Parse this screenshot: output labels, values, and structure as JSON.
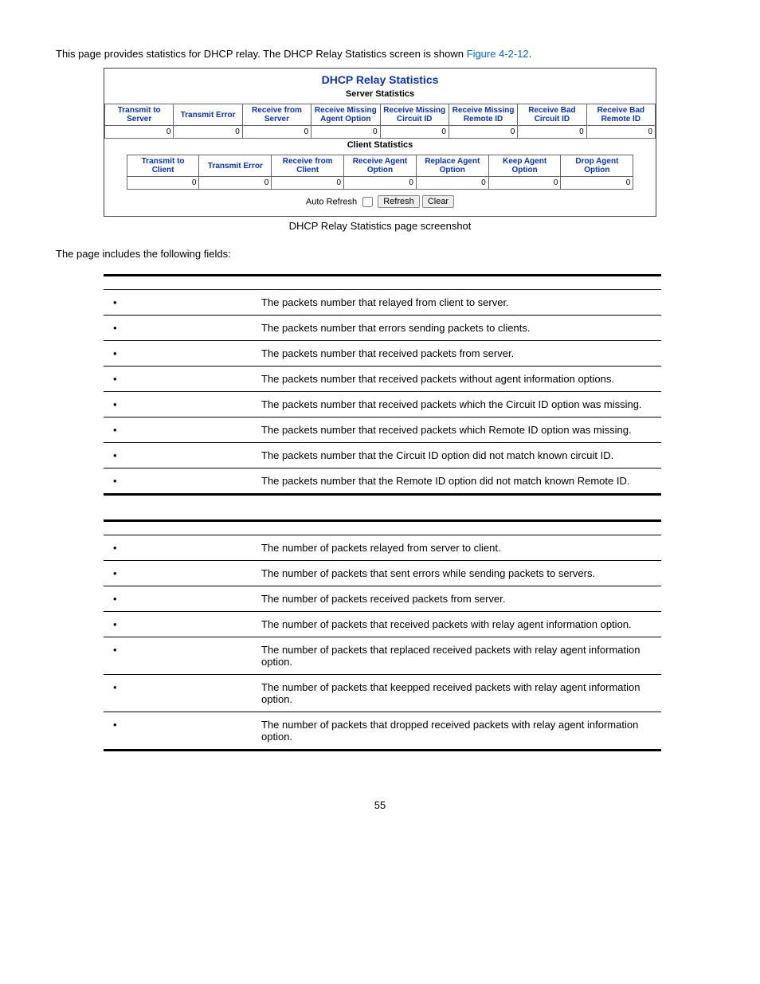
{
  "intro": {
    "text_before": "This page provides statistics for DHCP relay. The DHCP Relay Statistics screen is shown ",
    "link": "Figure 4-2-12",
    "text_after": "."
  },
  "screenshot": {
    "title": "DHCP Relay Statistics",
    "server_subtitle": "Server Statistics",
    "server_headers": [
      "Transmit to Server",
      "Transmit Error",
      "Receive from Server",
      "Receive Missing Agent Option",
      "Receive Missing Circuit ID",
      "Receive Missing Remote ID",
      "Receive Bad Circuit ID",
      "Receive Bad Remote ID"
    ],
    "server_values": [
      "0",
      "0",
      "0",
      "0",
      "0",
      "0",
      "0",
      "0"
    ],
    "client_subtitle": "Client Statistics",
    "client_headers": [
      "Transmit to Client",
      "Transmit Error",
      "Receive from Client",
      "Receive Agent Option",
      "Replace Agent Option",
      "Keep Agent Option",
      "Drop Agent Option"
    ],
    "client_values": [
      "0",
      "0",
      "0",
      "0",
      "0",
      "0",
      "0"
    ],
    "auto_refresh_label": "Auto Refresh",
    "refresh_btn": "Refresh",
    "clear_btn": "Clear"
  },
  "caption": "DHCP Relay Statistics page screenshot",
  "fields_intro": "The page includes the following fields:",
  "server_fields": [
    {
      "desc": "The packets number that relayed from client to server."
    },
    {
      "desc": "The packets number that errors sending packets to clients."
    },
    {
      "desc": "The packets number that received packets from server."
    },
    {
      "desc": "The packets number that received packets without agent information options."
    },
    {
      "desc": "The packets number that received packets which the Circuit ID option was missing."
    },
    {
      "desc": "The packets number that received packets which Remote ID option was missing."
    },
    {
      "desc": "The packets number that the Circuit ID option did not match known circuit ID."
    },
    {
      "desc": "The packets number that the Remote ID option did not match known Remote ID."
    }
  ],
  "client_fields": [
    {
      "desc": "The number of packets relayed from server to client."
    },
    {
      "desc": "The number of packets that sent errors while sending packets to servers."
    },
    {
      "desc": "The number of packets received packets from server."
    },
    {
      "desc": "The number of packets that received packets with relay agent information option."
    },
    {
      "desc": "The number of packets that replaced received packets with relay agent information option."
    },
    {
      "desc": "The number of packets that keepped received packets with relay agent information option."
    },
    {
      "desc": "The number of packets that dropped received packets with relay agent information option."
    }
  ],
  "page_number": "55"
}
